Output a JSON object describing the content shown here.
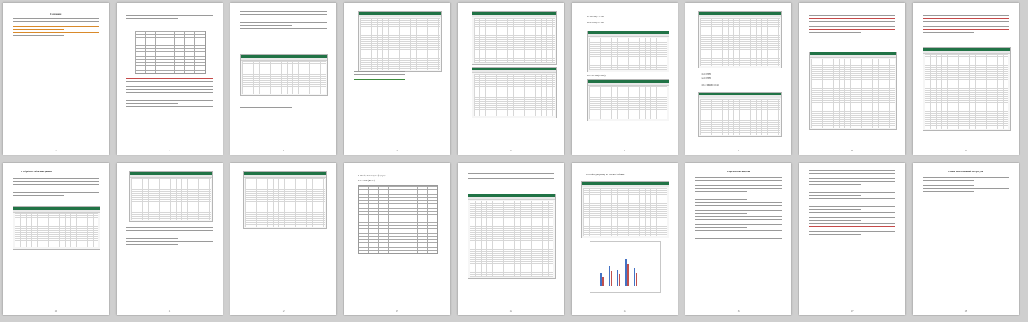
{
  "colors": {
    "background": "#cfcfcf",
    "page": "#ffffff",
    "excel_ribbon": "#217346",
    "highlight_red": "#c54a4a",
    "highlight_green": "#3d8a3d",
    "highlight_blue": "#4a6fc5",
    "chart_bar_blue": "#4472c4",
    "chart_bar_red": "#c0504d"
  },
  "pages": [
    {
      "number": "1",
      "heading": "Содержание",
      "text": ""
    },
    {
      "number": "2",
      "heading": "",
      "text": ""
    },
    {
      "number": "3",
      "heading": "",
      "text": ""
    },
    {
      "number": "4",
      "heading": "",
      "text": ""
    },
    {
      "number": "5",
      "heading": "",
      "text": ""
    },
    {
      "number": "6",
      "heading": "",
      "text": ""
    },
    {
      "number": "7",
      "heading": "",
      "text": ""
    },
    {
      "number": "8",
      "heading": "",
      "text": ""
    },
    {
      "number": "9",
      "heading": "",
      "text": ""
    },
    {
      "number": "10",
      "heading": "",
      "text": ""
    },
    {
      "number": "11",
      "heading": "",
      "text": ""
    },
    {
      "number": "12",
      "heading": "",
      "text": ""
    },
    {
      "number": "13",
      "heading": "",
      "text": ""
    },
    {
      "number": "14",
      "heading": "",
      "text": ""
    },
    {
      "number": "15",
      "heading": "",
      "text": ""
    },
    {
      "number": "16",
      "heading": "",
      "text": ""
    },
    {
      "number": "17",
      "heading": "",
      "text": ""
    },
    {
      "number": "18",
      "heading": "Список использованной литературы",
      "text": ""
    }
  ],
  "snippets": {
    "p7_a": "D1=ЕСЛИ(С1>100",
    "p7_b": "D2=ЕСЛИ(С2>100",
    "p7_c": "D10=СУММ(D1:D9)",
    "p8_a": "C1=СУММ",
    "p8_b": "C2=СУММ",
    "p8_c": "C10=СУММ(C1:C9)",
    "p12_a": "5. Ячейку D2 введите формулу",
    "p12_b": "D2=СУММ(B2:C2)",
    "p14_a": "Постройте диаграмму по итоговой таблице",
    "p15_a": "Теоретические вопросы",
    "p10_a": "2. Обработка табличных данных"
  }
}
